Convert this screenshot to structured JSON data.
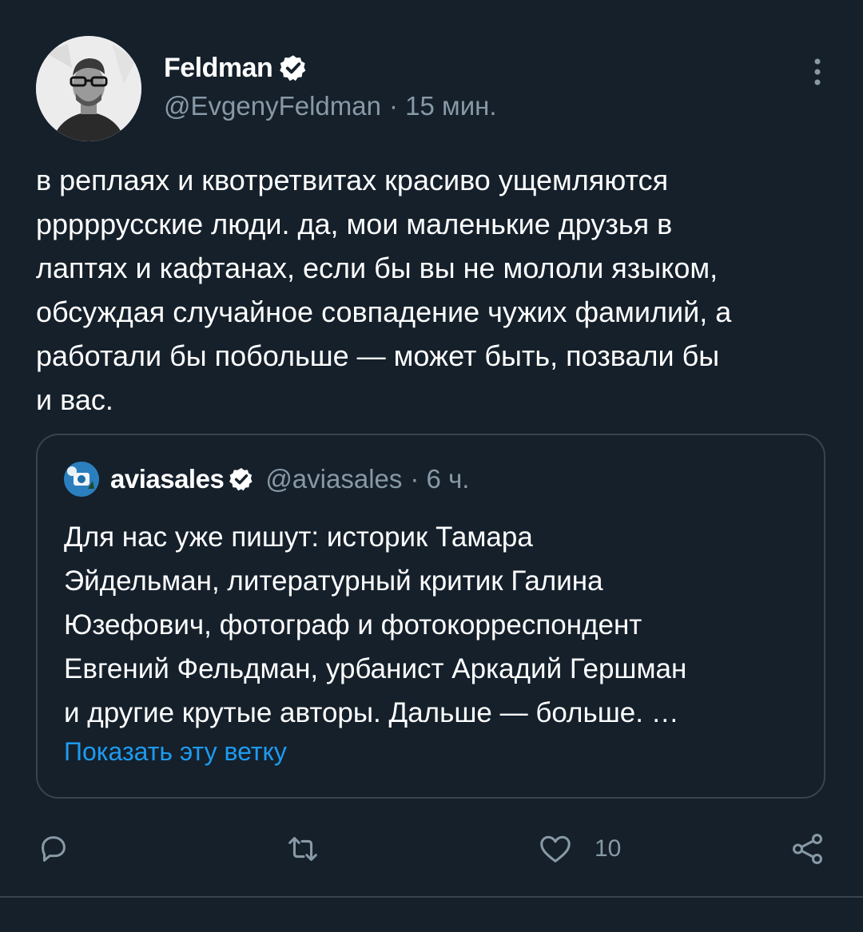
{
  "author": {
    "display_name": "Feldman",
    "handle": "@EvgenyFeldman",
    "time": "· 15 мин.",
    "avatar_icon": "person-photo-avatar",
    "verified_icon": "verified-badge-icon"
  },
  "tweet": {
    "lines": [
      "в реплаях и квотретвитах красиво ущемляются",
      "рррррусские люди. да, мои маленькие друзья в",
      "лаптях и кафтанах, если бы вы не мололи языком,",
      "обсуждая случайное совпадение чужих фамилий, а",
      "работали бы побольше — может быть, позвали бы",
      "и вас."
    ]
  },
  "quoted": {
    "display_name": "aviasales",
    "handle": "@aviasales",
    "time": "· 6 ч.",
    "lines": [
      "Для нас уже пишут: историк Тамара",
      "Эйдельман, литературный критик Галина",
      "Юзефович, фотограф и фотокорреспондент",
      "Евгений Фельдман, урбанист Аркадий Гершман",
      "и другие крутые авторы. Дальше — больше. …"
    ],
    "show_thread": "Показать эту ветку"
  },
  "actions": {
    "reply_icon": "reply-icon",
    "retweet_icon": "retweet-icon",
    "like_icon": "heart-icon",
    "like_count": "10",
    "share_icon": "share-icon"
  },
  "colors": {
    "background": "#15202b",
    "secondary_text": "#8899a6",
    "link": "#1d9bf0",
    "border": "#38444d"
  }
}
